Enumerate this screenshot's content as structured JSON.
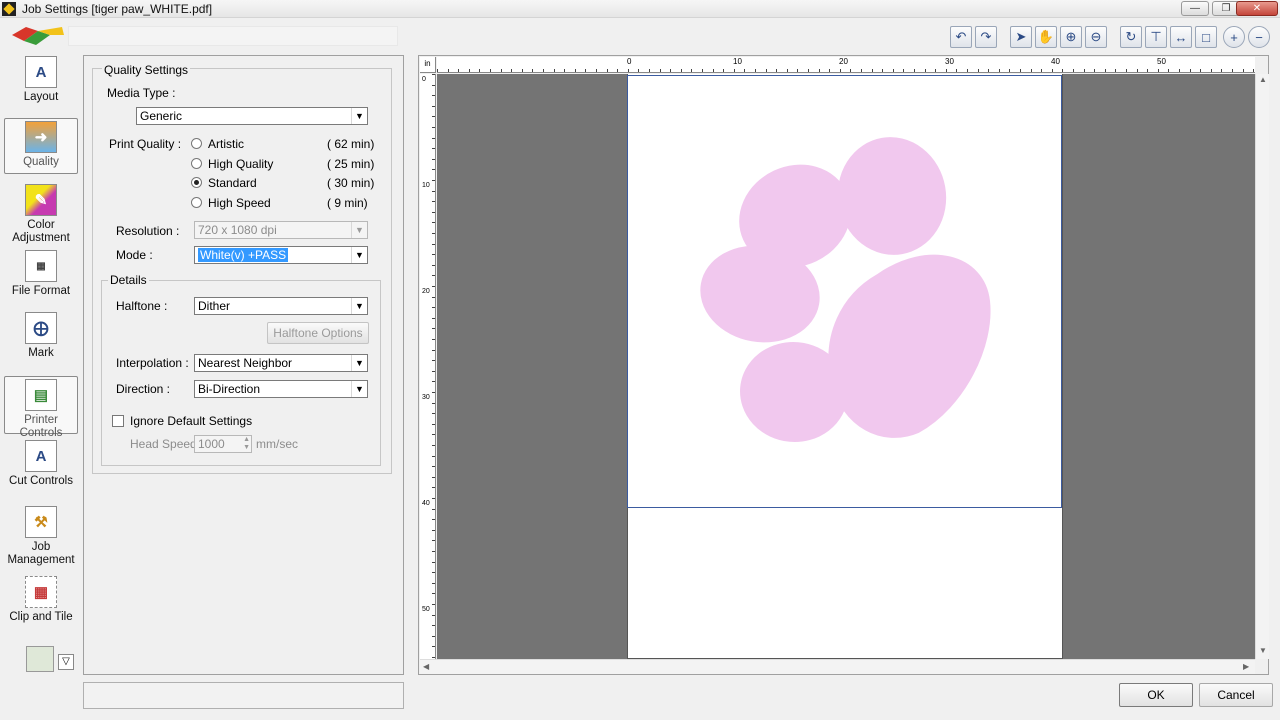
{
  "window": {
    "title": "Job Settings [tiger paw_WHITE.pdf]",
    "buttons": [
      "minimize",
      "maximize",
      "close"
    ]
  },
  "toolbar": {
    "icons": [
      "undo-icon",
      "redo-icon",
      "select-arrow-icon",
      "hand-pan-icon",
      "zoom-in-icon",
      "zoom-out-icon",
      "rotate-icon",
      "align-top-icon",
      "fit-width-icon",
      "fit-page-icon",
      "plus-circle-icon",
      "minus-circle-icon"
    ]
  },
  "sidebar": {
    "items": [
      {
        "label": "Layout",
        "icon": "layout-icon"
      },
      {
        "label": "Quality",
        "icon": "quality-icon"
      },
      {
        "label": "Color Adjustment",
        "icon": "color-adjustment-icon"
      },
      {
        "label": "File Format",
        "icon": "file-format-icon"
      },
      {
        "label": "Mark",
        "icon": "mark-icon"
      },
      {
        "label": "Printer Controls",
        "icon": "printer-controls-icon"
      },
      {
        "label": "Cut Controls",
        "icon": "cut-controls-icon"
      },
      {
        "label": "Job Management",
        "icon": "job-management-icon"
      },
      {
        "label": "Clip and Tile",
        "icon": "clip-and-tile-icon"
      }
    ],
    "active": "Quality"
  },
  "quality": {
    "group_title": "Quality Settings",
    "media_type_label": "Media Type :",
    "media_type_value": "Generic",
    "print_quality_label": "Print Quality :",
    "print_quality_options": [
      {
        "label": "Artistic",
        "time": "( 62 min)",
        "selected": false
      },
      {
        "label": "High Quality",
        "time": "( 25 min)",
        "selected": false
      },
      {
        "label": "Standard",
        "time": "( 30 min)",
        "selected": true
      },
      {
        "label": "High Speed",
        "time": "(  9 min)",
        "selected": false
      }
    ],
    "resolution_label": "Resolution :",
    "resolution_value": "720 x 1080 dpi",
    "mode_label": "Mode :",
    "mode_value": "White(v) +PASS"
  },
  "details": {
    "group_title": "Details",
    "halftone_label": "Halftone :",
    "halftone_value": "Dither",
    "halftone_options_button": "Halftone Options",
    "interpolation_label": "Interpolation :",
    "interpolation_value": "Nearest Neighbor",
    "direction_label": "Direction :",
    "direction_value": "Bi-Direction",
    "ignore_defaults_label": "Ignore Default Settings",
    "ignore_defaults_checked": false,
    "head_speed_label": "Head Speed",
    "head_speed_value": "1000",
    "head_speed_unit": "mm/sec"
  },
  "preview": {
    "ruler_unit": "in",
    "ruler_h_labels": [
      "0",
      "10",
      "20",
      "30",
      "40",
      "50"
    ],
    "ruler_v_labels": [
      "0",
      "10",
      "20",
      "30",
      "40",
      "50"
    ],
    "artwork_color": "#f1c8ee"
  },
  "footer": {
    "ok_label": "OK",
    "cancel_label": "Cancel"
  }
}
